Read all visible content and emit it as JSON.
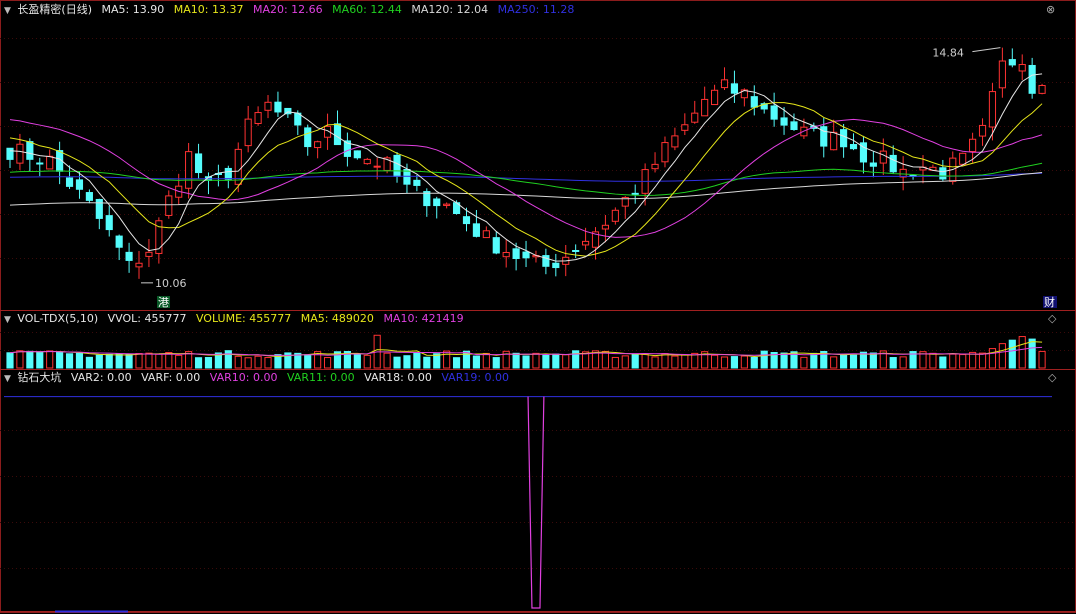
{
  "main": {
    "title": "长盈精密(日线)",
    "labels": [
      {
        "text": "MA5: 13.90",
        "color": "#e6e6e6"
      },
      {
        "text": "MA10: 13.37",
        "color": "#e6e61a"
      },
      {
        "text": "MA20: 12.66",
        "color": "#e040e0"
      },
      {
        "text": "MA60: 12.44",
        "color": "#20d020"
      },
      {
        "text": "MA120: 12.04",
        "color": "#d8d8d8"
      },
      {
        "text": "MA250: 11.28",
        "color": "#3030e0"
      }
    ],
    "high_label": "14.84",
    "low_label": "10.06",
    "marker_gang": "港",
    "marker_cai": "财"
  },
  "volume": {
    "title": "VOL-TDX(5,10)",
    "labels": [
      {
        "text": "VVOL: 455777",
        "color": "#e6e6e6"
      },
      {
        "text": "VOLUME: 455777",
        "color": "#e6e61a"
      },
      {
        "text": "MA5: 489020",
        "color": "#e6e61a"
      },
      {
        "text": "MA10: 421419",
        "color": "#e040e0"
      }
    ]
  },
  "indicator": {
    "title": "钻石大坑",
    "labels": [
      {
        "text": "VAR2: 0.00",
        "color": "#e6e6e6"
      },
      {
        "text": "VARF: 0.00",
        "color": "#e6e6e6"
      },
      {
        "text": "VAR10: 0.00",
        "color": "#e040e0"
      },
      {
        "text": "VAR11: 0.00",
        "color": "#20d020"
      },
      {
        "text": "VAR18: 0.00",
        "color": "#e6e6e6"
      },
      {
        "text": "VAR19: 0.00",
        "color": "#3030e0"
      }
    ]
  },
  "controls": {
    "close": "⊗",
    "diamond": "◇"
  },
  "chart_data": {
    "type": "candlestick",
    "colors": {
      "up": "#ff3232",
      "down": "#54fcfc",
      "ma5": "#e6e6e6",
      "ma10": "#e6e61a",
      "ma20": "#e040e0",
      "ma60": "#20d020",
      "ma120": "#d8d8d8",
      "ma250": "#3030e0"
    },
    "y_range": [
      9.9,
      15.0
    ],
    "anchors": [
      [
        0,
        12.6
      ],
      [
        4,
        12.4
      ],
      [
        8,
        11.6
      ],
      [
        10,
        11.1
      ],
      [
        12,
        10.5
      ],
      [
        14,
        10.8
      ],
      [
        16,
        11.7
      ],
      [
        18,
        12.5
      ],
      [
        20,
        11.9
      ],
      [
        22,
        12.2
      ],
      [
        24,
        13.0
      ],
      [
        26,
        13.4
      ],
      [
        28,
        13.1
      ],
      [
        30,
        12.7
      ],
      [
        32,
        12.9
      ],
      [
        34,
        12.6
      ],
      [
        38,
        12.3
      ],
      [
        40,
        11.9
      ],
      [
        44,
        11.6
      ],
      [
        48,
        11.0
      ],
      [
        52,
        10.6
      ],
      [
        54,
        10.5
      ],
      [
        56,
        10.7
      ],
      [
        58,
        11.0
      ],
      [
        60,
        11.3
      ],
      [
        62,
        11.7
      ],
      [
        64,
        12.1
      ],
      [
        66,
        12.6
      ],
      [
        68,
        13.0
      ],
      [
        70,
        13.5
      ],
      [
        72,
        13.7
      ],
      [
        74,
        13.6
      ],
      [
        76,
        13.3
      ],
      [
        78,
        13.1
      ],
      [
        80,
        12.9
      ],
      [
        82,
        12.8
      ],
      [
        84,
        12.8
      ],
      [
        86,
        12.5
      ],
      [
        88,
        12.4
      ],
      [
        90,
        12.2
      ],
      [
        92,
        12.3
      ],
      [
        94,
        12.2
      ],
      [
        96,
        12.4
      ],
      [
        98,
        12.9
      ],
      [
        100,
        14.1
      ],
      [
        102,
        14.3
      ],
      [
        103,
        13.7
      ],
      [
        104,
        13.9
      ]
    ],
    "volume_range": [
      0,
      1100000
    ],
    "volume_ma5": 489020,
    "volume_ma10": 421419,
    "volume_last": 455777,
    "indicator_range": [
      -1,
      0.05
    ],
    "indicator_dip_index": 53
  }
}
